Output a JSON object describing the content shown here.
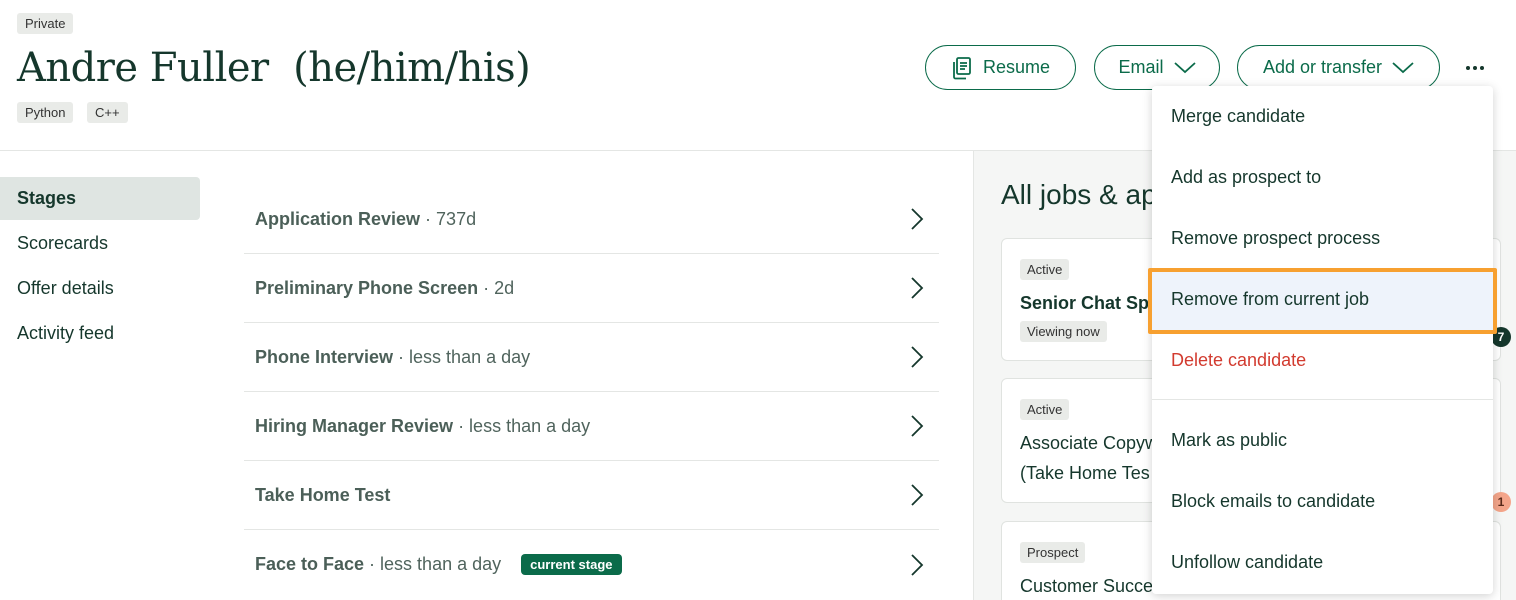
{
  "header": {
    "privacy_tag": "Private",
    "candidate_name": "Andre Fuller  (he/him/his)",
    "skill_tags": [
      "Python",
      "C++"
    ],
    "resume_label": "Resume",
    "email_label": "Email",
    "add_transfer_label": "Add or transfer",
    "more_icon": "more-horizontal-icon"
  },
  "sidebar": {
    "items": [
      {
        "label": "Stages",
        "active": true
      },
      {
        "label": "Scorecards",
        "active": false
      },
      {
        "label": "Offer details",
        "active": false
      },
      {
        "label": "Activity feed",
        "active": false
      }
    ]
  },
  "stages": [
    {
      "name": "Application Review",
      "duration": "· 737d"
    },
    {
      "name": "Preliminary Phone Screen",
      "duration": "· 2d"
    },
    {
      "name": "Phone Interview",
      "duration": "· less than a day"
    },
    {
      "name": "Hiring Manager Review",
      "duration": "· less than a day"
    },
    {
      "name": "Take Home Test",
      "duration": ""
    },
    {
      "name": "Face to Face",
      "duration": "· less than a day",
      "badge": "current stage"
    }
  ],
  "right_panel": {
    "title": "All jobs & ap",
    "cards": [
      {
        "status": "Active",
        "title": "Senior Chat Spe",
        "viewing": "Viewing now"
      },
      {
        "status": "Active",
        "title": "Associate Copyw",
        "subtitle": "(Take Home Tes"
      },
      {
        "status": "Prospect",
        "title": "Customer Succe"
      }
    ],
    "badges": [
      "7",
      "1"
    ]
  },
  "dropdown": {
    "items": [
      {
        "label": "Merge candidate"
      },
      {
        "label": "Add as prospect to"
      },
      {
        "label": "Remove prospect process"
      },
      {
        "label": "Remove from current job",
        "highlighted": true
      },
      {
        "label": "Delete candidate",
        "danger": true
      },
      {
        "label": "Mark as public"
      },
      {
        "label": "Block emails to candidate"
      },
      {
        "label": "Unfollow candidate"
      }
    ]
  },
  "colors": {
    "brand_green": "#0b6b4a",
    "text_dark": "#15372c",
    "danger": "#d23b2f",
    "focus_outline": "#f7a030"
  }
}
